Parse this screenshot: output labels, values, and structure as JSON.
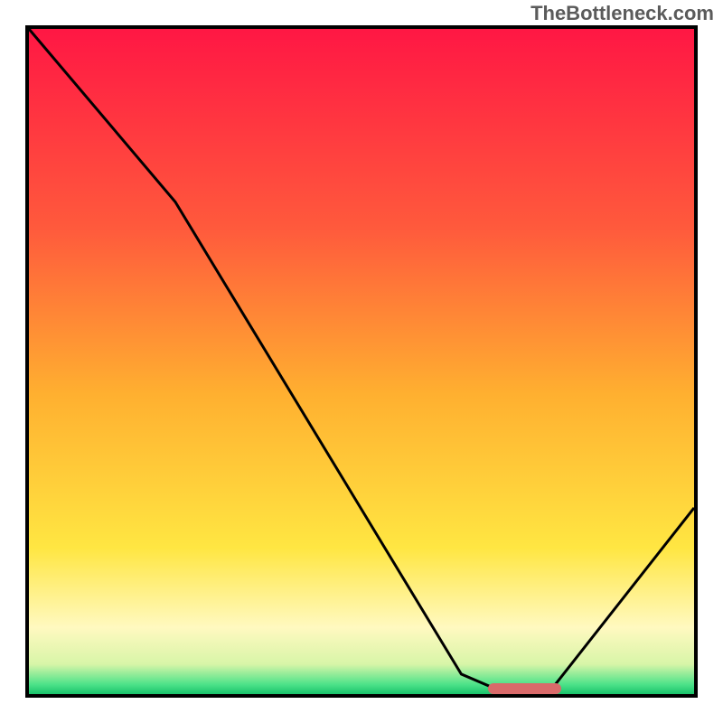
{
  "watermark": "TheBottleneck.com",
  "chart_data": {
    "type": "line",
    "title": "",
    "xlabel": "",
    "ylabel": "",
    "xlim": [
      0,
      100
    ],
    "ylim": [
      0,
      100
    ],
    "grid": false,
    "legend": false,
    "series": [
      {
        "name": "curve",
        "x": [
          0,
          22,
          65,
          72,
          78,
          100
        ],
        "values": [
          100,
          74,
          3,
          0,
          0,
          28
        ],
        "color": "#000000"
      }
    ],
    "background_gradient_stops": [
      {
        "offset": 0.0,
        "color": "#ff1744"
      },
      {
        "offset": 0.3,
        "color": "#ff5a3c"
      },
      {
        "offset": 0.55,
        "color": "#ffb030"
      },
      {
        "offset": 0.78,
        "color": "#ffe642"
      },
      {
        "offset": 0.9,
        "color": "#fff9c0"
      },
      {
        "offset": 0.955,
        "color": "#d8f5a8"
      },
      {
        "offset": 0.985,
        "color": "#4fe38a"
      },
      {
        "offset": 1.0,
        "color": "#19c36b"
      }
    ],
    "optimal_marker": {
      "x_start": 69,
      "x_end": 80,
      "y": 0.8,
      "color": "#d96a6a",
      "thickness_pct": 1.6
    }
  }
}
